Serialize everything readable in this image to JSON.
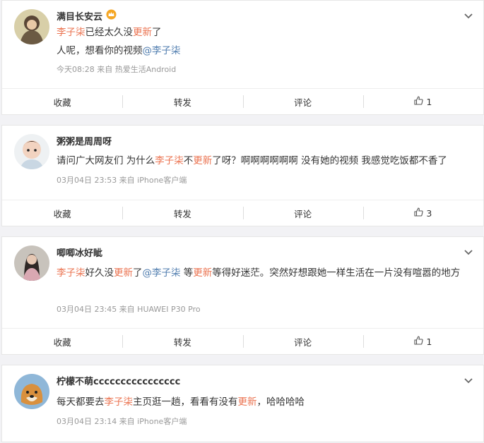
{
  "actions": {
    "save": "收藏",
    "repost": "转发",
    "comment": "评论"
  },
  "posts": [
    {
      "username": "满目长安云",
      "line1": [
        {
          "t": "李子柒",
          "c": "hl"
        },
        {
          "t": "已经太久没"
        },
        {
          "t": "更新",
          "c": "hl"
        },
        {
          "t": "了"
        }
      ],
      "line2": [
        {
          "t": "人呢，想看你的视频"
        },
        {
          "t": "@李子柒",
          "c": "at"
        }
      ],
      "meta": "今天08:28  来自 热爱生活Android",
      "likes": "1"
    },
    {
      "username": "粥粥是周周呀",
      "line1": [
        {
          "t": "请问广大网友们 为什么"
        },
        {
          "t": "李子柒",
          "c": "hl"
        },
        {
          "t": "不"
        },
        {
          "t": "更新",
          "c": "hl"
        },
        {
          "t": "了呀？啊啊啊啊啊啊 没有她的视频 我感觉吃饭都不香了"
        }
      ],
      "meta": "03月04日 23:53  来自 iPhone客户端",
      "likes": "3"
    },
    {
      "username": "唧唧冰好眦",
      "line1": [
        {
          "t": "李子柒",
          "c": "hl"
        },
        {
          "t": "好久没"
        },
        {
          "t": "更新",
          "c": "hl"
        },
        {
          "t": "了"
        },
        {
          "t": "@李子柒",
          "c": "at"
        },
        {
          "t": " 等"
        },
        {
          "t": "更新",
          "c": "hl"
        },
        {
          "t": "等得好迷茫。突然好想跟她一样生活在一片没有喧嚣的地方"
        }
      ],
      "meta": "03月04日 23:45  来自 HUAWEI P30 Pro",
      "likes": "1"
    },
    {
      "username": "柠檬不萌cccccccccccccccc",
      "line1": [
        {
          "t": "每天都要去"
        },
        {
          "t": "李子柒",
          "c": "hl"
        },
        {
          "t": "主页逛一趟，看看有没有"
        },
        {
          "t": "更新",
          "c": "hl"
        },
        {
          "t": "，哈哈哈哈"
        }
      ],
      "meta": "03月04日 23:14  来自 iPhone客户端"
    }
  ]
}
